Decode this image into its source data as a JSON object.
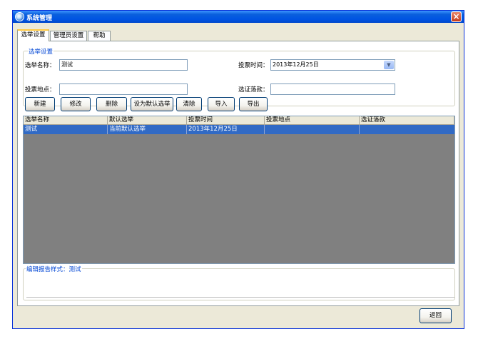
{
  "window": {
    "title": "系统管理",
    "close_glyph": "×"
  },
  "tabs": [
    {
      "label": "选举设置",
      "active": true
    },
    {
      "label": "管理员设置",
      "active": false
    },
    {
      "label": "帮助",
      "active": false
    }
  ],
  "settings_group": {
    "title": "选举设置",
    "name_label": "选举名称：",
    "name_value": "测试",
    "vote_time_label": "投票时间：",
    "vote_time_value": "2013年12月25日",
    "location_label": "投票地点：",
    "location_value": "",
    "cert_label": "选证落款：",
    "cert_value": ""
  },
  "buttons": {
    "new": "新建",
    "edit": "修改",
    "delete": "删除",
    "set_default": "设为默认选举",
    "clear": "清除",
    "import": "导入",
    "export": "导出",
    "return": "返回"
  },
  "grid": {
    "columns": [
      "选举名称",
      "默认选举",
      "投票时间",
      "投票地点",
      "选证落款"
    ],
    "rows": [
      [
        "测试",
        "当前默认选举",
        "2013年12月25日",
        "",
        ""
      ]
    ]
  },
  "report_group": {
    "title": "编辑报告样式：测试"
  },
  "colors": {
    "titlebar": "#0054e3",
    "selection": "#316ac5",
    "grid_background": "#808080",
    "group_title": "#0046d5"
  },
  "icons": {
    "app": "app-icon",
    "close": "close-icon",
    "combo": "chevron-down-icon"
  }
}
